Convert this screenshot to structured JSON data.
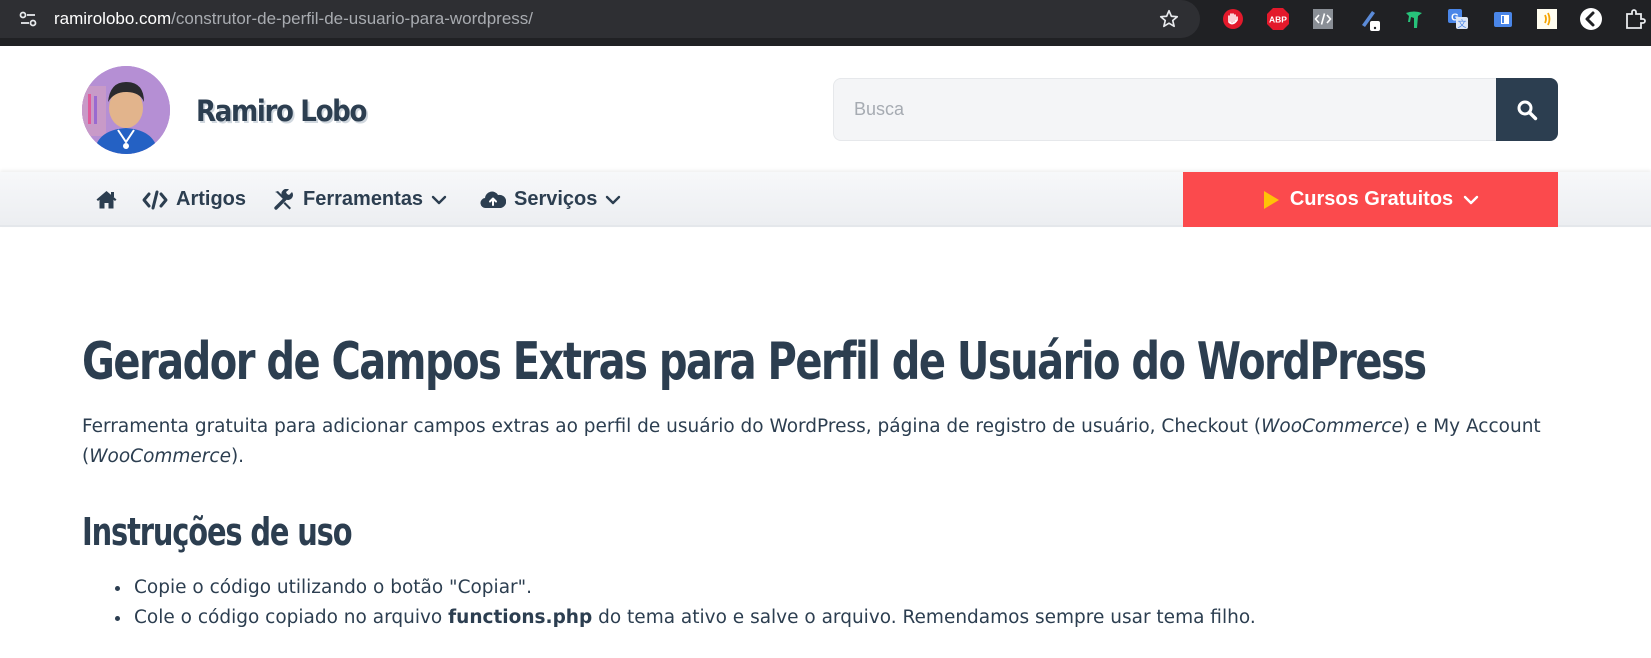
{
  "browser": {
    "url_host": "ramirolobo.com",
    "url_path": "/construtor-de-perfil-de-usuario-para-wordpress/",
    "extensions": [
      {
        "name": "adblock-icon",
        "color": "#e3192b"
      },
      {
        "name": "abp-icon",
        "color": "#e3192b",
        "text": "ABP"
      },
      {
        "name": "code-icon",
        "color": "#8a8f96"
      },
      {
        "name": "pen-icon",
        "color": "#e8eaed"
      },
      {
        "name": "figure-icon",
        "color": "#27c27a"
      },
      {
        "name": "translate-icon",
        "color": "#4a86e8"
      },
      {
        "name": "clipboard-icon",
        "color": "#4a86e8"
      },
      {
        "name": "audio-icon",
        "color": "#f5c518"
      },
      {
        "name": "back-icon",
        "color": "#ffffff"
      },
      {
        "name": "puzzle-icon",
        "color": "#e8eaed"
      }
    ]
  },
  "header": {
    "site_title": "Ramiro Lobo",
    "search_placeholder": "Busca"
  },
  "nav": {
    "items": [
      {
        "label": "Artigos",
        "icon": "code-icon"
      },
      {
        "label": "Ferramentas",
        "icon": "tools-icon"
      },
      {
        "label": "Serviços",
        "icon": "cloud-upload-icon"
      }
    ],
    "cta_label": "Cursos Gratuitos",
    "cta_color": "#fb4a4d"
  },
  "content": {
    "title": "Gerador de Campos Extras para Perfil de Usuário do WordPress",
    "intro_1": "Ferramenta gratuita para adicionar campos extras ao perfil de usuário do WordPress, página de registro de usuário, Checkout (",
    "intro_em_1": "WooCommerce",
    "intro_2": ") e My Account (",
    "intro_em_2": "WooCommerce",
    "intro_3": ").",
    "section_title": "Instruções de uso",
    "step_1": "Copie o código utilizando o botão \"Copiar\".",
    "step_2_pre": "Cole o código copiado no arquivo ",
    "step_2_bold": "functions.php",
    "step_2_post": " do tema ativo e salve o arquivo. Remendamos sempre usar tema filho."
  },
  "colors": {
    "text": "#2c3e50",
    "accent": "#fb4a4d",
    "browser_bg": "#202124"
  }
}
